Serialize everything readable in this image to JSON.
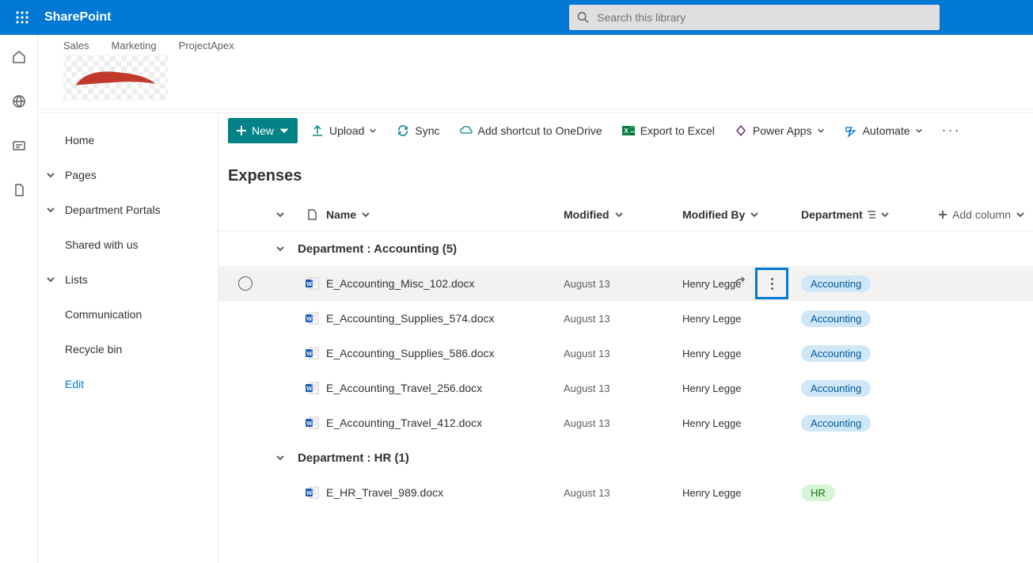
{
  "header": {
    "brand": "SharePoint",
    "search_placeholder": "Search this library"
  },
  "site_tabs": [
    "Sales",
    "Marketing",
    "ProjectApex"
  ],
  "leftnav": {
    "home": "Home",
    "pages": "Pages",
    "dept_portals": "Department Portals",
    "shared": "Shared with us",
    "lists": "Lists",
    "communication": "Communication",
    "recycle": "Recycle bin",
    "edit": "Edit"
  },
  "commands": {
    "new": "New",
    "upload": "Upload",
    "sync": "Sync",
    "shortcut": "Add shortcut to OneDrive",
    "export": "Export to Excel",
    "powerapps": "Power Apps",
    "automate": "Automate"
  },
  "library": {
    "title": "Expenses",
    "columns": {
      "name": "Name",
      "modified": "Modified",
      "modified_by": "Modified By",
      "department": "Department",
      "add": "Add column"
    },
    "groups": [
      {
        "label": "Department : Accounting (5)",
        "rows": [
          {
            "name": "E_Accounting_Misc_102.docx",
            "modified": "August 13",
            "modified_by": "Henry Legge",
            "dept": "Accounting",
            "dept_style": "acc",
            "hovered": true
          },
          {
            "name": "E_Accounting_Supplies_574.docx",
            "modified": "August 13",
            "modified_by": "Henry Legge",
            "dept": "Accounting",
            "dept_style": "acc"
          },
          {
            "name": "E_Accounting_Supplies_586.docx",
            "modified": "August 13",
            "modified_by": "Henry Legge",
            "dept": "Accounting",
            "dept_style": "acc"
          },
          {
            "name": "E_Accounting_Travel_256.docx",
            "modified": "August 13",
            "modified_by": "Henry Legge",
            "dept": "Accounting",
            "dept_style": "acc"
          },
          {
            "name": "E_Accounting_Travel_412.docx",
            "modified": "August 13",
            "modified_by": "Henry Legge",
            "dept": "Accounting",
            "dept_style": "acc"
          }
        ]
      },
      {
        "label": "Department : HR (1)",
        "rows": [
          {
            "name": "E_HR_Travel_989.docx",
            "modified": "August 13",
            "modified_by": "Henry Legge",
            "dept": "HR",
            "dept_style": "hr"
          }
        ]
      }
    ]
  }
}
